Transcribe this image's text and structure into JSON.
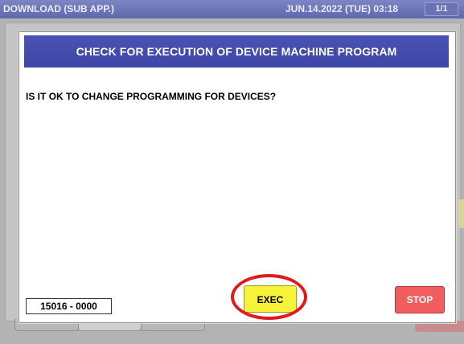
{
  "app": {
    "title": "DOWNLOAD (SUB APP.)",
    "datetime": "JUN.14.2022 (TUE)  03:18",
    "page_indicator": "1/1"
  },
  "dialog": {
    "title": "CHECK FOR EXECUTION OF DEVICE MACHINE PROGRAM",
    "question": "IS IT OK TO CHANGE PROGRAMMING FOR DEVICES?",
    "code": "15016 - 0000",
    "exec_label": "EXEC",
    "stop_label": "STOP"
  },
  "colors": {
    "header_blue": "#3d45a6",
    "exec_yellow": "#f7f23a",
    "stop_red": "#f25e5e",
    "highlight_red": "#e11b1b"
  }
}
